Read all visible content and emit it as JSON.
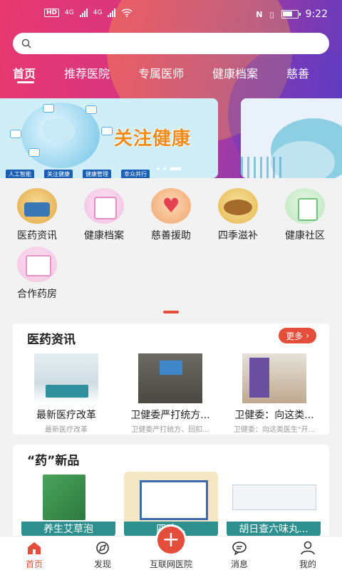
{
  "status_bar": {
    "network_badge": "HD",
    "signal_a": "4G",
    "signal_b": "4G",
    "time": "9:22"
  },
  "search": {
    "placeholder": ""
  },
  "tabs": [
    {
      "label": "首页",
      "active": true
    },
    {
      "label": "推荐医院"
    },
    {
      "label": "专属医师"
    },
    {
      "label": "健康档案"
    },
    {
      "label": "慈善"
    }
  ],
  "banner": {
    "title": "关注健康",
    "pills": [
      "人工智能",
      "关注健康",
      "健康管理",
      "幸众共行"
    ]
  },
  "categories": [
    {
      "label": "医药资讯",
      "icon": "news-icon"
    },
    {
      "label": "健康档案",
      "icon": "health-file-icon"
    },
    {
      "label": "慈善援助",
      "icon": "charity-heart-icon"
    },
    {
      "label": "四季滋补",
      "icon": "seasonal-tonic-icon"
    },
    {
      "label": "健康社区",
      "icon": "community-icon"
    },
    {
      "label": "合作药房",
      "icon": "pharmacy-icon"
    }
  ],
  "news_section": {
    "title": "医药资讯",
    "more_label": "更多",
    "items": [
      {
        "headline": "最新医疗改革",
        "sub": "最新医疗改革"
      },
      {
        "headline": "卫健委严打统方...",
        "sub": "卫健委严打统方、回扣..."
      },
      {
        "headline": "卫健委：向这类...",
        "sub": "卫健委：向这类医生\"开..."
      }
    ]
  },
  "drug_section": {
    "title": "“药”新品",
    "items": [
      {
        "name": "养生艾草泡"
      },
      {
        "name": "四味..."
      },
      {
        "name": "胡日查六味丸..."
      }
    ]
  },
  "bottom_nav": [
    {
      "label": "首页",
      "icon": "home-icon",
      "active": true
    },
    {
      "label": "发现",
      "icon": "discover-icon"
    },
    {
      "label": "互联网医院",
      "icon": "plus-icon"
    },
    {
      "label": "消息",
      "icon": "message-icon"
    },
    {
      "label": "我的",
      "icon": "profile-icon"
    }
  ],
  "colors": {
    "accent": "#e44d3a",
    "teal": "#2e8f8f",
    "banner_title": "#f08b1c"
  }
}
